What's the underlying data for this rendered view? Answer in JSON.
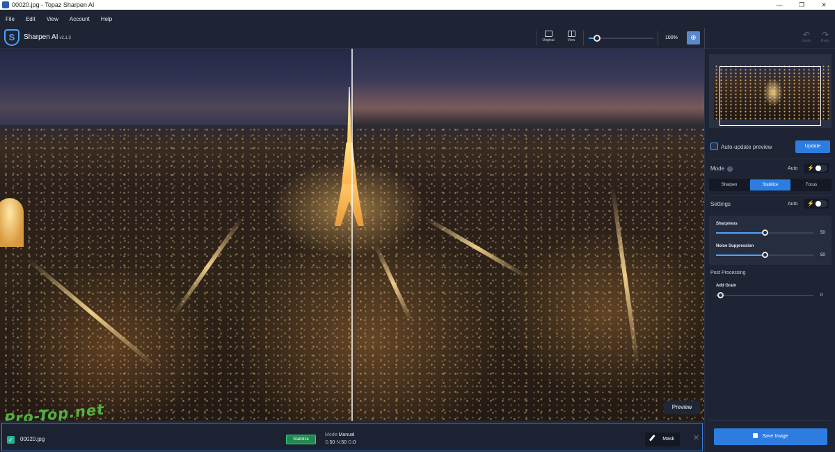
{
  "window": {
    "title": "00020.jpg - Topaz Sharpen AI",
    "controls": [
      "—",
      "❐",
      "✕"
    ]
  },
  "menu": [
    "File",
    "Edit",
    "View",
    "Account",
    "Help"
  ],
  "toolbar": {
    "app_name": "Sharpen AI",
    "version": "v2.1.3",
    "original_label": "Original",
    "view_label": "View",
    "zoom": "100%",
    "zoom_level_fraction": 0.12,
    "undo_label": "Undo",
    "redo_label": "Redo"
  },
  "canvas": {
    "preview_label": "Preview"
  },
  "statusbar": {
    "checked": "✓",
    "filename": "00020.jpg",
    "mode_badge": "Stabilize",
    "mode_prefix": "Mode:",
    "mode_value": "Manual",
    "s_label": "S:",
    "s_value": "50",
    "n_label": "N:",
    "n_value": "50",
    "g_label": "G:",
    "g_value": "0",
    "mask_label": "Mask",
    "close": "✕",
    "watermark": "Pro-Top.net"
  },
  "panel": {
    "auto_update_label": "Auto-update preview",
    "update_label": "Update",
    "mode_label": "Mode",
    "help": "?",
    "auto_label": "Auto",
    "bolt": "⚡",
    "mode_tabs": [
      "Sharpen",
      "Stabilize",
      "Focus"
    ],
    "active_mode": "Stabilize",
    "settings_label": "Settings",
    "sharpness_label": "Sharpness",
    "sharpness_value": "50",
    "sharpness_fraction": 0.5,
    "noise_label": "Noise Suppression",
    "noise_value": "50",
    "noise_fraction": 0.5,
    "post_processing_label": "Post Processing",
    "grain_label": "Add Grain",
    "grain_value": "0",
    "save_label": "Save Image"
  },
  "colors": {
    "accent": "#2d7de0",
    "badge_green": "#1f8a4e",
    "background": "#1b2130"
  },
  "icons": [
    "app-logo-icon",
    "original-icon",
    "view-icon",
    "zoom-in-icon",
    "undo-icon",
    "redo-icon",
    "checkbox-icon",
    "help-icon",
    "bolt-icon",
    "brush-icon",
    "close-icon",
    "disk-icon"
  ]
}
